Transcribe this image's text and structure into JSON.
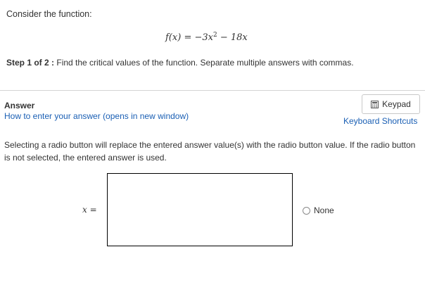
{
  "question": {
    "prompt": "Consider the function:",
    "equation": {
      "lhs": "f(x)",
      "equals": "=",
      "coef": "−3x",
      "exponent": "2",
      "rest": "− 18x"
    },
    "step_label": "Step 1 of 2 :",
    "step_text": "Find the critical values of the function. Separate multiple answers with commas."
  },
  "answer": {
    "heading": "Answer",
    "howto_link": "How to enter your answer (opens in new window)",
    "keypad_label": "Keypad",
    "shortcuts_link": "Keyboard Shortcuts",
    "notice": "Selecting a radio button will replace the entered answer value(s) with the radio button value. If the radio button is not selected, the entered answer is used.",
    "variable": "x",
    "equals": "=",
    "input_value": "",
    "radio_label": "None"
  },
  "icons": {
    "keypad": "keypad-icon",
    "radio": "radio-icon"
  }
}
